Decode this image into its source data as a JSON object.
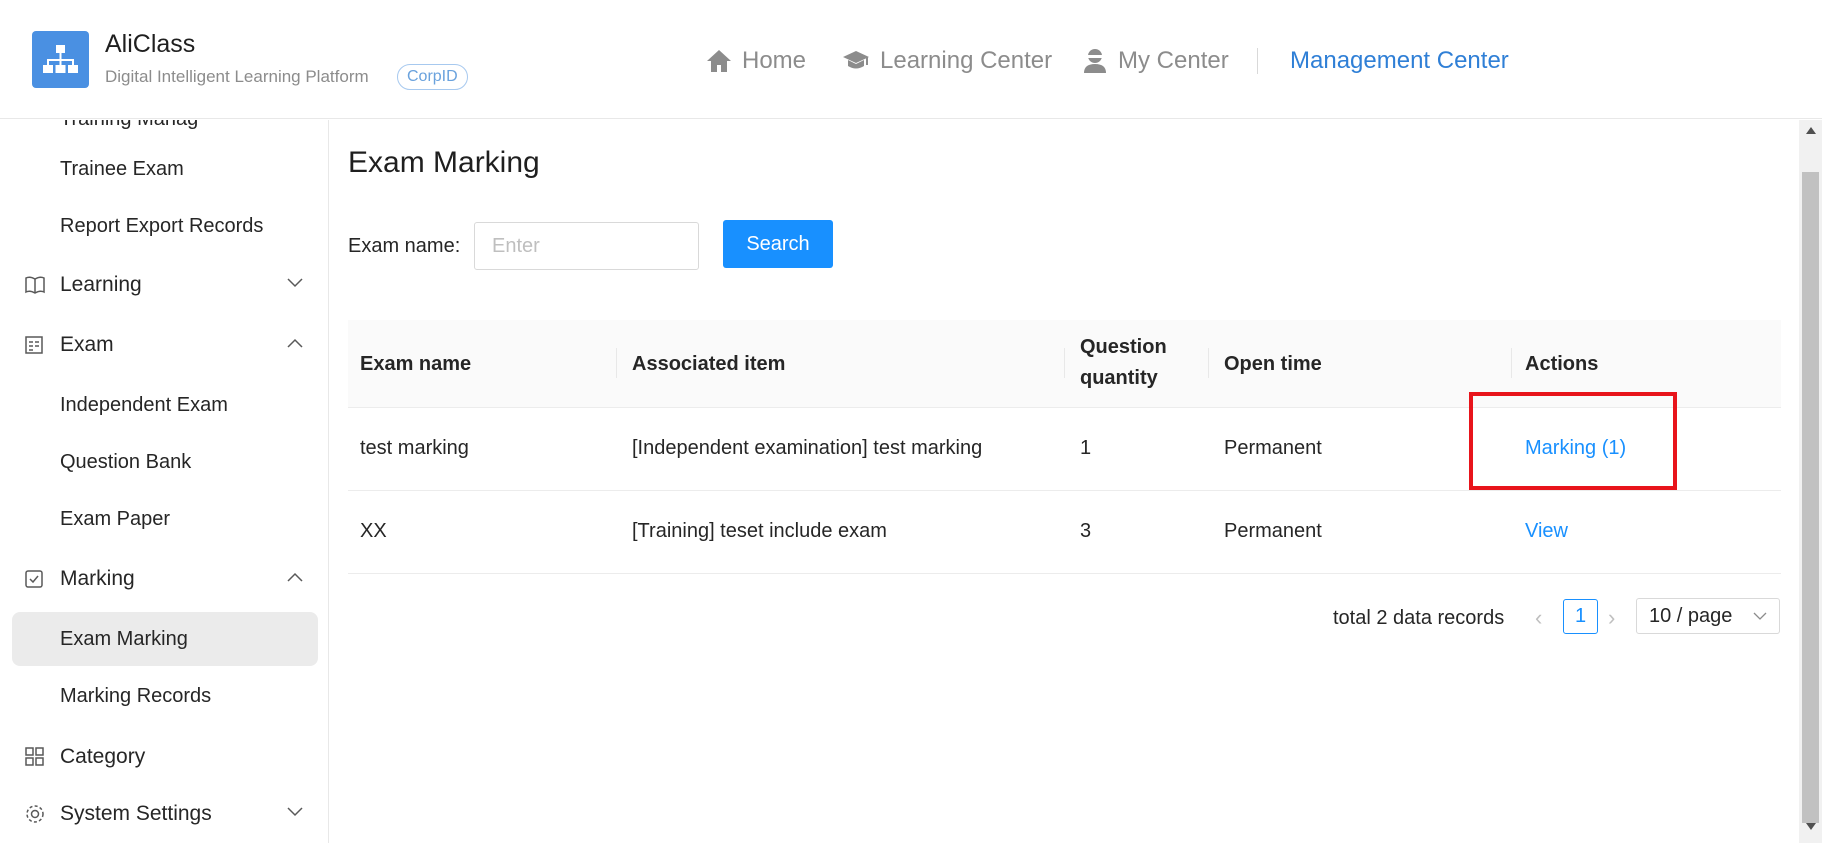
{
  "header": {
    "brand_name": "AliClass",
    "brand_sub": "Digital Intelligent Learning Platform",
    "corp_badge": "CorpID",
    "nav": {
      "home": "Home",
      "learning_center": "Learning Center",
      "my_center": "My Center",
      "management_center": "Management Center"
    }
  },
  "sidebar": {
    "cut_item": "Training Manag",
    "trainee_exam": "Trainee Exam",
    "report_export_records": "Report Export Records",
    "learning": "Learning",
    "exam": "Exam",
    "independent_exam": "Independent Exam",
    "question_bank": "Question Bank",
    "exam_paper": "Exam Paper",
    "marking": "Marking",
    "exam_marking": "Exam Marking",
    "marking_records": "Marking Records",
    "category": "Category",
    "system_settings": "System Settings"
  },
  "main": {
    "title": "Exam Marking",
    "search_label": "Exam name:",
    "search_placeholder": "Enter",
    "search_button": "Search",
    "columns": {
      "exam_name": "Exam name",
      "associated_item": "Associated item",
      "question_quantity_1": "Question",
      "question_quantity_2": "quantity",
      "open_time": "Open time",
      "actions": "Actions"
    },
    "rows": [
      {
        "exam_name": "test marking",
        "associated_item": "[Independent examination] test marking",
        "question_quantity": "1",
        "open_time": "Permanent",
        "action": "Marking (1)"
      },
      {
        "exam_name": "XX",
        "associated_item": "[Training] teset include exam",
        "question_quantity": "3",
        "open_time": "Permanent",
        "action": "View"
      }
    ],
    "pagination": {
      "total": "total 2 data records",
      "current_page": "1",
      "page_size": "10 / page"
    }
  },
  "colors": {
    "primary": "#1890ff",
    "management_center": "#2f7fd6",
    "highlight": "#e8141b",
    "logo_bg": "#4a90e2"
  }
}
